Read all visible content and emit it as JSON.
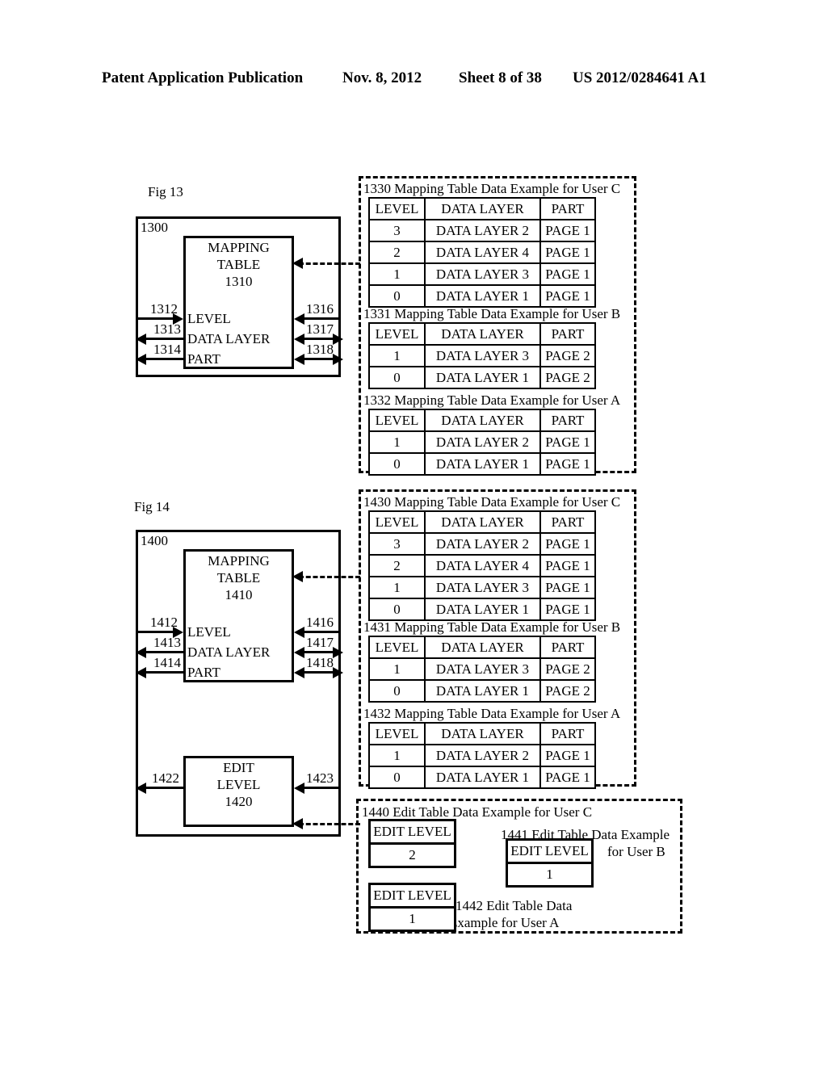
{
  "header": {
    "publication": "Patent Application Publication",
    "date": "Nov. 8, 2012",
    "sheet": "Sheet 8 of 38",
    "patent_number": "US 2012/0284641 A1"
  },
  "figures": [
    {
      "label": "Fig 13",
      "outer_box_number": "1300",
      "block": {
        "title_line1": "MAPPING",
        "title_line2": "TABLE",
        "number": "1310",
        "fields": [
          "LEVEL",
          "DATA LAYER",
          "PART"
        ]
      },
      "left_arrows": [
        {
          "label": "1312",
          "direction": "right"
        },
        {
          "label": "1313",
          "direction": "left"
        },
        {
          "label": "1314",
          "direction": "left"
        }
      ],
      "right_arrows": [
        {
          "label": "1316",
          "direction": "left"
        },
        {
          "label": "1317",
          "direction": "both"
        },
        {
          "label": "1318",
          "direction": "both"
        }
      ],
      "tables": [
        {
          "caption": "1330 Mapping Table Data Example for User C",
          "headers": [
            "LEVEL",
            "DATA LAYER",
            "PART"
          ],
          "rows": [
            [
              "3",
              "DATA LAYER 2",
              "PAGE 1"
            ],
            [
              "2",
              "DATA LAYER 4",
              "PAGE 1"
            ],
            [
              "1",
              "DATA LAYER 3",
              "PAGE 1"
            ],
            [
              "0",
              "DATA LAYER 1",
              "PAGE 1"
            ]
          ]
        },
        {
          "caption": "1331 Mapping Table Data Example for User B",
          "headers": [
            "LEVEL",
            "DATA LAYER",
            "PART"
          ],
          "rows": [
            [
              "1",
              "DATA LAYER 3",
              "PAGE 2"
            ],
            [
              "0",
              "DATA LAYER 1",
              "PAGE 2"
            ]
          ]
        },
        {
          "caption": "1332 Mapping Table Data Example for User A",
          "headers": [
            "LEVEL",
            "DATA LAYER",
            "PART"
          ],
          "rows": [
            [
              "1",
              "DATA LAYER 2",
              "PAGE 1"
            ],
            [
              "0",
              "DATA LAYER 1",
              "PAGE 1"
            ]
          ]
        }
      ]
    },
    {
      "label": "Fig 14",
      "outer_box_number": "1400",
      "block": {
        "title_line1": "MAPPING",
        "title_line2": "TABLE",
        "number": "1410",
        "fields": [
          "LEVEL",
          "DATA LAYER",
          "PART"
        ]
      },
      "edit_block": {
        "title_line1": "EDIT",
        "title_line2": "LEVEL",
        "number": "1420"
      },
      "left_arrows": [
        {
          "label": "1412",
          "direction": "right"
        },
        {
          "label": "1413",
          "direction": "left"
        },
        {
          "label": "1414",
          "direction": "left"
        }
      ],
      "right_arrows": [
        {
          "label": "1416",
          "direction": "left"
        },
        {
          "label": "1417",
          "direction": "both"
        },
        {
          "label": "1418",
          "direction": "both"
        }
      ],
      "edit_arrows": [
        {
          "label": "1422",
          "direction": "left"
        },
        {
          "label": "1423",
          "direction": "left"
        }
      ],
      "tables": [
        {
          "caption": "1430 Mapping Table Data Example for User C",
          "headers": [
            "LEVEL",
            "DATA LAYER",
            "PART"
          ],
          "rows": [
            [
              "3",
              "DATA LAYER 2",
              "PAGE 1"
            ],
            [
              "2",
              "DATA LAYER 4",
              "PAGE 1"
            ],
            [
              "1",
              "DATA LAYER 3",
              "PAGE 1"
            ],
            [
              "0",
              "DATA LAYER 1",
              "PAGE 1"
            ]
          ]
        },
        {
          "caption": "1431 Mapping Table Data Example for User B",
          "headers": [
            "LEVEL",
            "DATA LAYER",
            "PART"
          ],
          "rows": [
            [
              "1",
              "DATA LAYER 3",
              "PAGE 2"
            ],
            [
              "0",
              "DATA LAYER 1",
              "PAGE 2"
            ]
          ]
        },
        {
          "caption": "1432 Mapping Table Data Example for User A",
          "headers": [
            "LEVEL",
            "DATA LAYER",
            "PART"
          ],
          "rows": [
            [
              "1",
              "DATA LAYER 2",
              "PAGE 1"
            ],
            [
              "0",
              "DATA LAYER 1",
              "PAGE 1"
            ]
          ]
        }
      ],
      "edit_tables": [
        {
          "caption": "1440 Edit Table Data Example for User C",
          "header": "EDIT LEVEL",
          "value": "2"
        },
        {
          "caption_line1": "1441 Edit Table Data Example",
          "caption_line2": "for User B",
          "header": "EDIT LEVEL",
          "value": "1"
        },
        {
          "caption_line1": "1442 Edit Table Data",
          "caption_line2": "Example for User A",
          "header": "EDIT LEVEL",
          "value": "1"
        }
      ]
    }
  ]
}
